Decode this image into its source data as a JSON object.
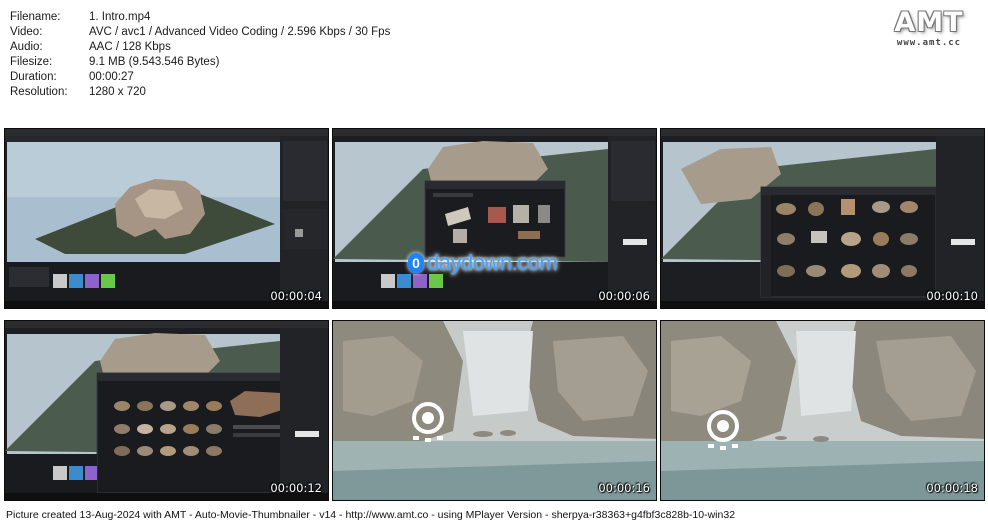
{
  "file_info": [
    {
      "key": "Filename:",
      "value": "1. Intro.mp4"
    },
    {
      "key": "Video:",
      "value": "AVC / avc1 / Advanced Video Coding / 2.596 Kbps / 30 Fps"
    },
    {
      "key": "Audio:",
      "value": "AAC / 128 Kbps"
    },
    {
      "key": "Filesize:",
      "value": "9.1 MB (9.543.546 Bytes)"
    },
    {
      "key": "Duration:",
      "value": "00:00:27"
    },
    {
      "key": "Resolution:",
      "value": "1280 x 720"
    }
  ],
  "logo": {
    "title": "AMT",
    "url": "www.amt.cc"
  },
  "thumbnails": [
    {
      "timecode": "00:00:04"
    },
    {
      "timecode": "00:00:06"
    },
    {
      "timecode": "00:00:10"
    },
    {
      "timecode": "00:00:12"
    },
    {
      "timecode": "00:00:16"
    },
    {
      "timecode": "00:00:18"
    }
  ],
  "watermark": {
    "badge": "0",
    "text": "daydown.com"
  },
  "footer": "Picture created 13-Aug-2024 with AMT - Auto-Movie-Thumbnailer - v14 - http://www.amt.co - using MPlayer Version - sherpya-r38363+g4fbf3c828b-10-win32"
}
